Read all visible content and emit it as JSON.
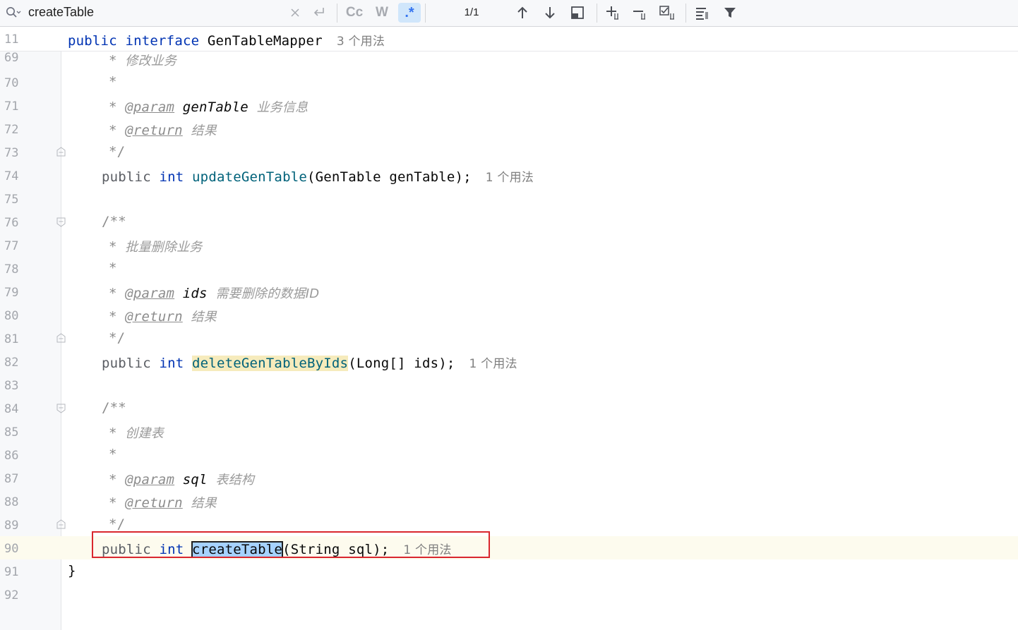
{
  "find_bar": {
    "query": "createTable",
    "match_case_label": "Cc",
    "words_label": "W",
    "regex_label": ".*",
    "match_count": "1/1"
  },
  "sticky_line": {
    "number": "11",
    "kw1": "public",
    "kw2": "interface",
    "name": "GenTableMapper",
    "usages": "3 个用法"
  },
  "lines": [
    {
      "n": "69"
    },
    {
      "n": "70"
    },
    {
      "n": "71"
    },
    {
      "n": "72"
    },
    {
      "n": "73"
    },
    {
      "n": "74"
    },
    {
      "n": "75"
    },
    {
      "n": "76"
    },
    {
      "n": "77"
    },
    {
      "n": "78"
    },
    {
      "n": "79"
    },
    {
      "n": "80"
    },
    {
      "n": "81"
    },
    {
      "n": "82"
    },
    {
      "n": "83"
    },
    {
      "n": "84"
    },
    {
      "n": "85"
    },
    {
      "n": "86"
    },
    {
      "n": "87"
    },
    {
      "n": "88"
    },
    {
      "n": "89"
    },
    {
      "n": "90"
    },
    {
      "n": "91"
    },
    {
      "n": "92"
    }
  ],
  "code": {
    "star": "*",
    "end_comment": "*/",
    "open_comment": "/**",
    "param_tag": "@param",
    "return_tag": "@return",
    "kw_public": "public",
    "kw_int": "int",
    "c69": "修改业务",
    "p71_name": "genTable",
    "p71_desc": "业务信息",
    "result": "结果",
    "m74_name": "updateGenTable",
    "m74_args": "(GenTable genTable);",
    "m74_usages": "1 个用法",
    "c77": "批量删除业务",
    "p79_name": "ids",
    "p79_desc": "需要删除的数据ID",
    "m82_name": "deleteGenTableByIds",
    "m82_args": "(Long[] ids);",
    "m82_usages": "1 个用法",
    "c85": "创建表",
    "p87_name": "sql",
    "p87_desc": "表结构",
    "m90_name": "createTable",
    "m90_args": "(String sql);",
    "m90_usages": "1 个用法",
    "close_brace": "}"
  },
  "colors": {
    "keyword": "#0033b3",
    "method": "#00627a",
    "comment": "#8c8c8c",
    "highlight_box": "#d9272e"
  }
}
